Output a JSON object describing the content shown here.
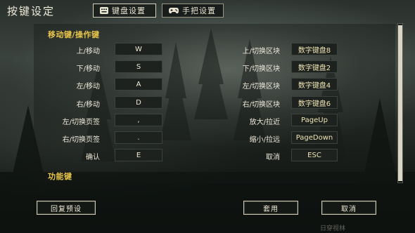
{
  "window": {
    "title": "按键设定"
  },
  "tabs": [
    {
      "label": "键盘设置",
      "icon": "keyboard-icon",
      "active": true
    },
    {
      "label": "手把设置",
      "icon": "gamepad-icon",
      "active": false
    }
  ],
  "sections": {
    "movement_title": "移动键/操作键",
    "function_title": "功能键"
  },
  "left_bindings": [
    {
      "label": "上/移动",
      "key": "W"
    },
    {
      "label": "下/移动",
      "key": "S"
    },
    {
      "label": "左/移动",
      "key": "A"
    },
    {
      "label": "右/移动",
      "key": "D"
    },
    {
      "label": "左/切换页签",
      "key": ","
    },
    {
      "label": "右/切换页签",
      "key": "."
    },
    {
      "label": "确认",
      "key": "E"
    }
  ],
  "right_bindings": [
    {
      "label": "上/切换区块",
      "key": "数字键盘8"
    },
    {
      "label": "下/切换区块",
      "key": "数字键盘2"
    },
    {
      "label": "左/切换区块",
      "key": "数字键盘4"
    },
    {
      "label": "右/切换区块",
      "key": "数字键盘6"
    },
    {
      "label": "放大/拉近",
      "key": "PageUp"
    },
    {
      "label": "缩小/拉远",
      "key": "PageDown"
    },
    {
      "label": "取消",
      "key": "ESC"
    }
  ],
  "buttons": {
    "reset": "回复预设",
    "apply": "套用",
    "cancel": "取消"
  },
  "footer_hint": "日穿视林",
  "colors": {
    "section_title": "#e7c54a",
    "text": "#eee9d8",
    "key_box": "#1e221f"
  }
}
